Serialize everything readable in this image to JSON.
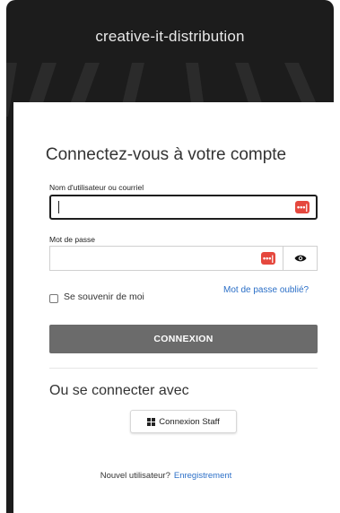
{
  "header": {
    "brand": "creative-it-distribution"
  },
  "login": {
    "title": "Connectez-vous à votre compte",
    "username_label": "Nom d'utilisateur ou courriel",
    "username_value": "",
    "password_label": "Mot de passe",
    "password_value": "",
    "remember_label": "Se souvenir de moi",
    "forgot_label": "Mot de passe oublié?",
    "submit_label": "CONNEXION"
  },
  "alt": {
    "title": "Ou se connecter avec",
    "staff_label": "Connexion Staff"
  },
  "footer": {
    "new_user": "Nouvel utilisateur?",
    "register": "Enregistrement"
  },
  "icons": {
    "password_manager": "password-manager-icon",
    "eye": "eye-icon",
    "windows": "windows-icon"
  },
  "colors": {
    "background": "#1c1c1c",
    "accent": "#2b6fc7",
    "button": "#6b6b6b",
    "pm_icon": "#e5483e"
  }
}
